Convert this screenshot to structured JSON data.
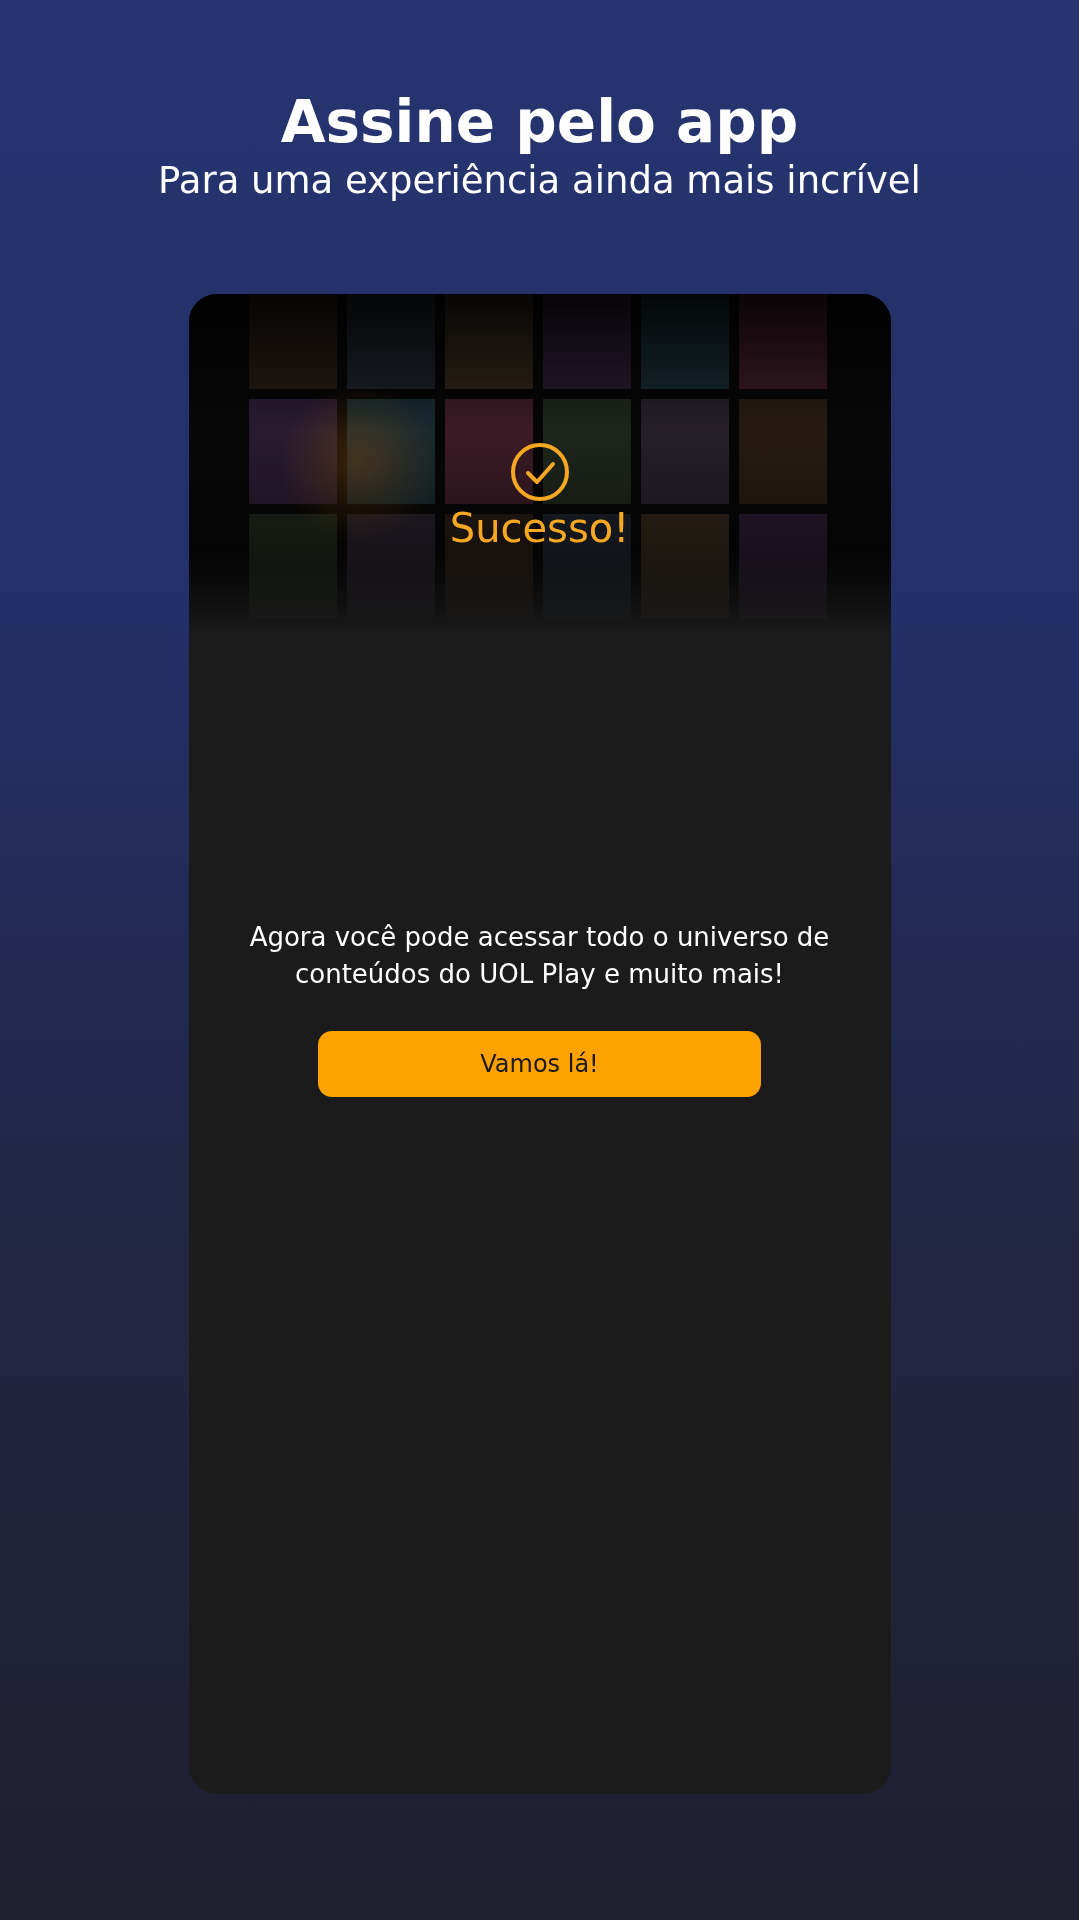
{
  "header": {
    "title": "Assine pelo app",
    "subtitle": "Para uma experiência ainda mais incrível"
  },
  "card": {
    "status": {
      "title": "Sucesso!"
    },
    "message": "Agora você pode acessar todo o universo de conteúdos do UOL Play e muito mais!",
    "button": {
      "label": "Vamos lá!"
    }
  }
}
